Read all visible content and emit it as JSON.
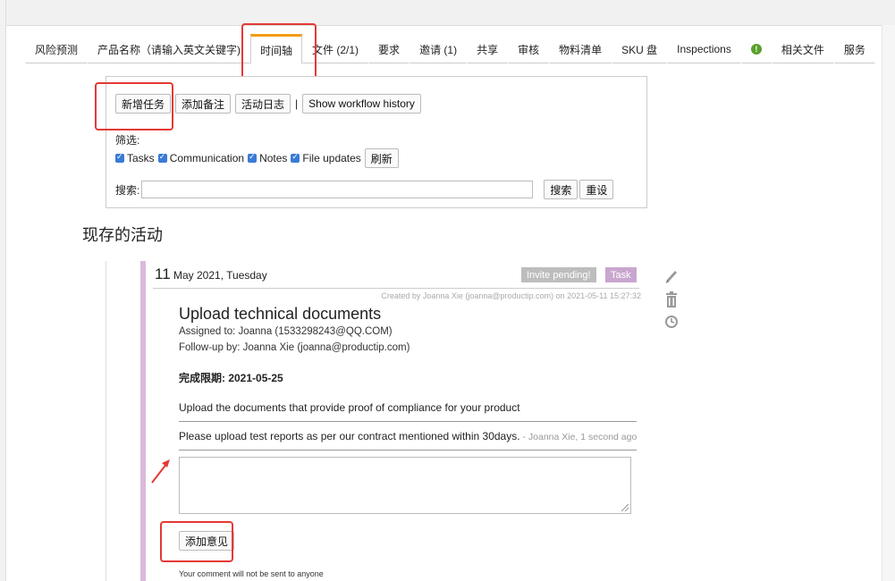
{
  "tabs": [
    {
      "label": "风险预测"
    },
    {
      "label": "产品名称（请输入英文关键字)"
    },
    {
      "label": "时间轴",
      "active": true
    },
    {
      "label": "文件 (2/1)"
    },
    {
      "label": "要求"
    },
    {
      "label": "邀请 (1)"
    },
    {
      "label": "共享"
    },
    {
      "label": "审核"
    },
    {
      "label": "物料清单"
    },
    {
      "label": "SKU 盘"
    },
    {
      "label": "Inspections"
    },
    {
      "icon": "info-icon"
    },
    {
      "label": "相关文件"
    },
    {
      "label": "服务"
    }
  ],
  "toolbar": {
    "new_task": "新增任务",
    "add_note": "添加备注",
    "activity_log": "活动日志",
    "separator": "|",
    "workflow_history": "Show workflow history"
  },
  "filter": {
    "label": "筛选:",
    "options": [
      {
        "label": "Tasks",
        "checked": true
      },
      {
        "label": "Communication",
        "checked": true
      },
      {
        "label": "Notes",
        "checked": true
      },
      {
        "label": "File updates",
        "checked": true
      }
    ],
    "refresh": "刷新",
    "search_label": "搜索:",
    "search_value": "",
    "search_btn": "搜索",
    "reset_btn": "重设"
  },
  "section_title": "现存的活动",
  "activity": {
    "day": "11",
    "date_rest": "May 2021, Tuesday",
    "badge_pending": "Invite pending!",
    "badge_task": "Task",
    "created": "Created by Joanna Xie (joanna@productip.com) on 2021-05-11 15:27:32",
    "title": "Upload technical documents",
    "assigned": "Assigned to: Joanna (1533298243@QQ.COM)",
    "followup": "Follow-up by: Joanna Xie (joanna@productip.com)",
    "deadline": "完成限期: 2021-05-25",
    "description": "Upload the documents that provide proof of compliance for your product",
    "comment_text": "Please upload test reports as per our contract mentioned within 30days.",
    "comment_by": " - Joanna Xie, 1 second ago",
    "add_comment": "添加意见",
    "note": "Your comment will not be sent to anyone"
  },
  "colors": {
    "accent_tab": "#f39c12",
    "highlight": "#e53935",
    "badge_grey": "#bdbdbd",
    "badge_task": "#c9a6cf",
    "checkbox": "#3a7bd5"
  }
}
